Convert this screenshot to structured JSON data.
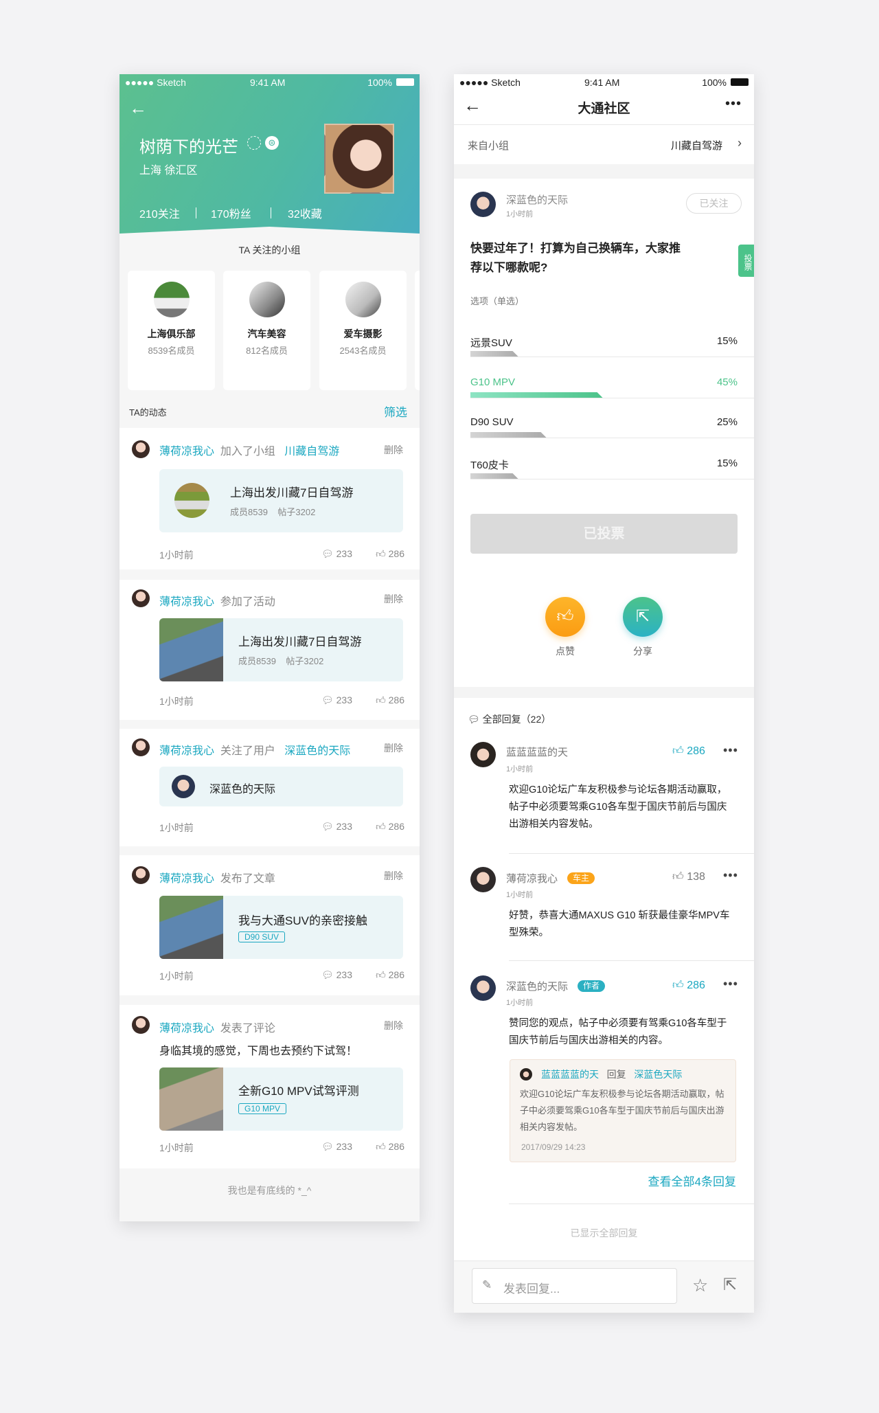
{
  "status": {
    "carrier": "●●●●● Sketch",
    "time": "9:41 AM",
    "battery": "100%"
  },
  "profile": {
    "name": "树荫下的光芒",
    "location": "上海 徐汇区",
    "stats": [
      "210关注",
      "170粉丝",
      "32收藏"
    ],
    "groups_title": "TA 关注的小组",
    "groups": [
      {
        "name": "上海俱乐部",
        "members": "8539名成员"
      },
      {
        "name": "汽车美容",
        "members": "812名成员"
      },
      {
        "name": "爱车摄影",
        "members": "2543名成员"
      }
    ],
    "feed_title": "TA的动态",
    "filter": "筛选",
    "feed": [
      {
        "user": "薄荷凉我心",
        "action": "加入了小组",
        "target": "川藏自驾游",
        "delete": "删除",
        "title": "上海出发川藏7日自驾游",
        "meta1": "成员8539",
        "meta2": "帖子3202",
        "time": "1小时前",
        "comments": "233",
        "likes": "286"
      },
      {
        "user": "薄荷凉我心",
        "action": "参加了活动",
        "delete": "删除",
        "title": "上海出发川藏7日自驾游",
        "meta1": "成员8539",
        "meta2": "帖子3202",
        "time": "1小时前",
        "comments": "233",
        "likes": "286"
      },
      {
        "user": "薄荷凉我心",
        "action": "关注了用户",
        "target": "深蓝色的天际",
        "delete": "删除",
        "title": "深蓝色的天际",
        "time": "1小时前",
        "comments": "233",
        "likes": "286"
      },
      {
        "user": "薄荷凉我心",
        "action": "发布了文章",
        "delete": "删除",
        "title": "我与大通SUV的亲密接触",
        "tag": "D90 SUV",
        "time": "1小时前",
        "comments": "233",
        "likes": "286"
      },
      {
        "user": "薄荷凉我心",
        "action": "发表了评论",
        "delete": "删除",
        "text": "身临其境的感觉，下周也去预约下试驾！",
        "title": "全新G10 MPV试驾评测",
        "tag": "G10 MPV",
        "time": "1小时前",
        "comments": "233",
        "likes": "286"
      }
    ],
    "end_text": "我也是有底线的 *_^"
  },
  "post": {
    "nav_title": "大通社区",
    "from_label": "来自小组",
    "from_group": "川藏自驾游",
    "author": "深蓝色的天际",
    "author_time": "1小时前",
    "follow": "已关注",
    "question": "快要过年了！打算为自己换辆车，大家推荐以下哪款呢?",
    "vote_tab": "投票",
    "options_label": "选项（单选）",
    "options": [
      {
        "label": "远景SUV",
        "pct": "15%",
        "value": 15
      },
      {
        "label": "G10 MPV",
        "pct": "45%",
        "value": 45
      },
      {
        "label": "D90 SUV",
        "pct": "25%",
        "value": 25
      },
      {
        "label": "T60皮卡",
        "pct": "15%",
        "value": 15
      }
    ],
    "voted": "已投票",
    "like": "点赞",
    "share": "分享",
    "replies_title": "全部回复（22）",
    "comments": [
      {
        "name": "蓝蓝蓝蓝的天",
        "time": "1小时前",
        "likes": "286",
        "text": "欢迎G10论坛广车友积极参与论坛各期活动赢取，帖子中必须要驾乘G10各车型于国庆节前后与国庆出游相关内容发帖。"
      },
      {
        "name": "薄荷凉我心",
        "badge": "车主",
        "time": "1小时前",
        "likes": "138",
        "text": "好赞，恭喜大通MAXUS G10 斩获最佳豪华MPV车型殊荣。"
      },
      {
        "name": "深蓝色的天际",
        "badge": "作者",
        "time": "1小时前",
        "likes": "286",
        "text": "赞同您的观点，帖子中必须要有驾乘G10各车型于国庆节前后与国庆出游相关的内容。",
        "quote": {
          "from": "蓝蓝蓝蓝的天",
          "reply": "回复",
          "to": "深蓝色天际",
          "text": "欢迎G10论坛广车友积极参与论坛各期活动赢取，帖子中必须要驾乘G10各车型于国庆节前后与国庆出游相关内容发帖。",
          "date": "2017/09/29  14:23"
        },
        "view_all": "查看全部4条回复"
      }
    ],
    "all_shown": "已显示全部回复",
    "reply_placeholder": "发表回复..."
  },
  "colors": {
    "teal": "#1aa7c0",
    "green": "#4cc38a",
    "orange": "#fba41a"
  }
}
